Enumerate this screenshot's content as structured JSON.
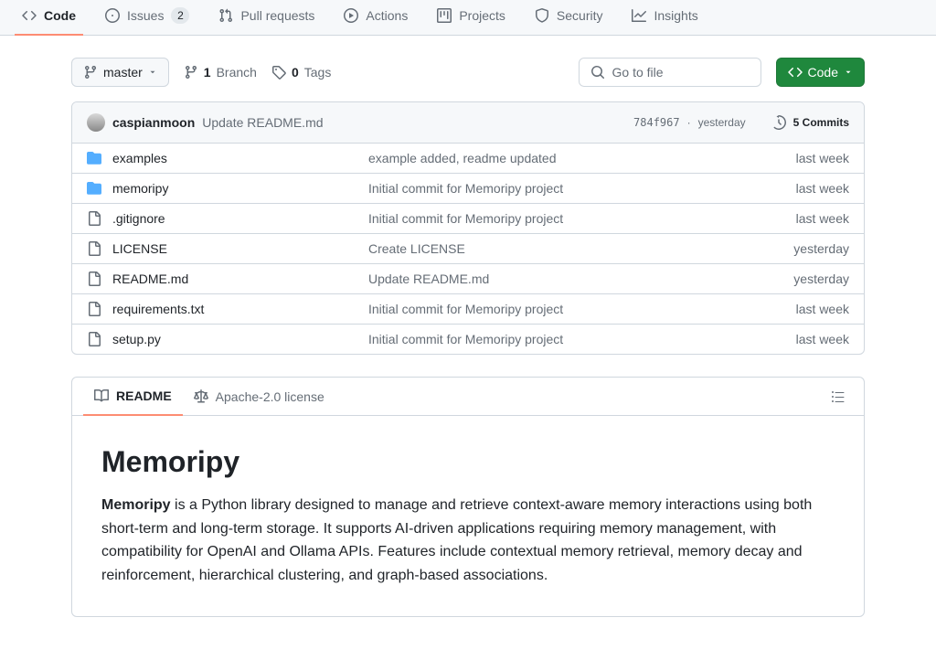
{
  "tabs": [
    {
      "id": "code",
      "label": "Code",
      "count": null,
      "active": true
    },
    {
      "id": "issues",
      "label": "Issues",
      "count": "2",
      "active": false
    },
    {
      "id": "pulls",
      "label": "Pull requests",
      "count": null,
      "active": false
    },
    {
      "id": "actions",
      "label": "Actions",
      "count": null,
      "active": false
    },
    {
      "id": "projects",
      "label": "Projects",
      "count": null,
      "active": false
    },
    {
      "id": "security",
      "label": "Security",
      "count": null,
      "active": false
    },
    {
      "id": "insights",
      "label": "Insights",
      "count": null,
      "active": false
    }
  ],
  "branch_button": "master",
  "branch_count": "1",
  "branch_label": "Branch",
  "tag_count": "0",
  "tag_label": "Tags",
  "search_placeholder": "Go to file",
  "code_button": "Code",
  "commit": {
    "author": "caspianmoon",
    "message": "Update README.md",
    "sha": "784f967",
    "date": "yesterday",
    "count": "5 Commits"
  },
  "files": [
    {
      "type": "folder",
      "name": "examples",
      "msg": "example added, readme updated",
      "date": "last week"
    },
    {
      "type": "folder",
      "name": "memoripy",
      "msg": "Initial commit for Memoripy project",
      "date": "last week"
    },
    {
      "type": "file",
      "name": ".gitignore",
      "msg": "Initial commit for Memoripy project",
      "date": "last week"
    },
    {
      "type": "file",
      "name": "LICENSE",
      "msg": "Create LICENSE",
      "date": "yesterday"
    },
    {
      "type": "file",
      "name": "README.md",
      "msg": "Update README.md",
      "date": "yesterday"
    },
    {
      "type": "file",
      "name": "requirements.txt",
      "msg": "Initial commit for Memoripy project",
      "date": "last week"
    },
    {
      "type": "file",
      "name": "setup.py",
      "msg": "Initial commit for Memoripy project",
      "date": "last week"
    }
  ],
  "readme": {
    "tab_readme": "README",
    "tab_license": "Apache-2.0 license",
    "title": "Memoripy",
    "intro_bold": "Memoripy",
    "intro_rest": " is a Python library designed to manage and retrieve context-aware memory interactions using both short-term and long-term storage. It supports AI-driven applications requiring memory management, with compatibility for OpenAI and Ollama APIs. Features include contextual memory retrieval, memory decay and reinforcement, hierarchical clustering, and graph-based associations."
  }
}
